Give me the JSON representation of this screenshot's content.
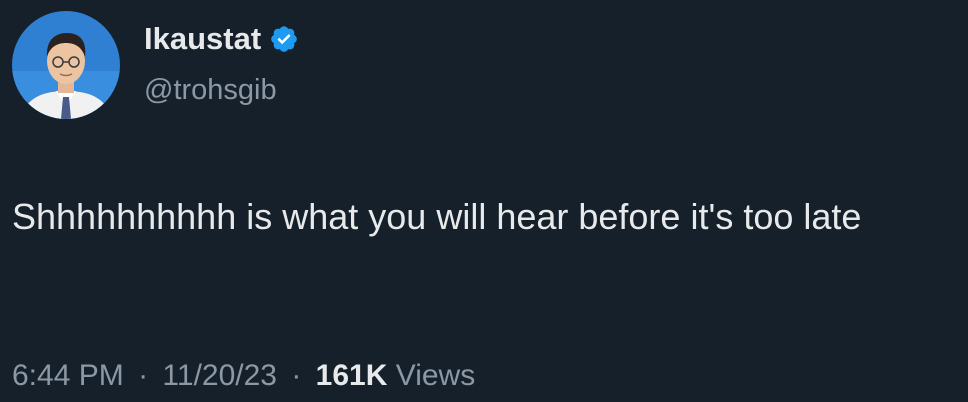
{
  "author": {
    "display_name": "Ikaustat",
    "handle": "@trohsgib",
    "verified_icon": "verified-badge-icon",
    "avatar_icon": "profile-photo"
  },
  "tweet": {
    "text": "Shhhhhhhhhh is what you will hear before it's too late"
  },
  "meta": {
    "time": "6:44 PM",
    "separator": "·",
    "date": "11/20/23",
    "views_count": "161K",
    "views_label": "Views"
  },
  "colors": {
    "background": "#15202b",
    "primary_text": "#e7e9ea",
    "secondary_text": "#8b98a5",
    "verified_blue": "#1d9bf0"
  }
}
